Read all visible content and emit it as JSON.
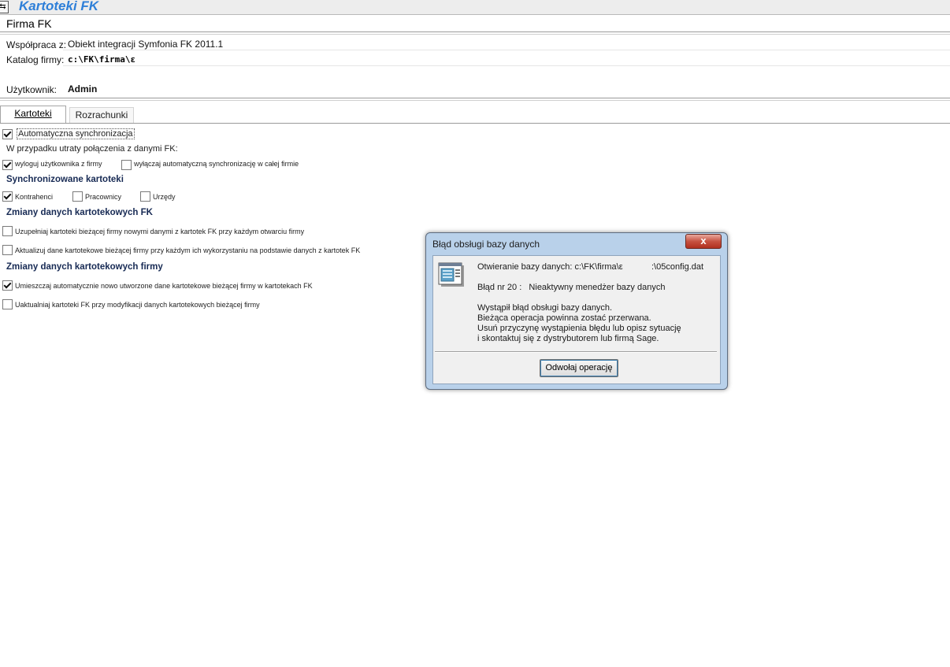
{
  "app": {
    "title": "Kartoteki FK",
    "menu_icon": "restore-icon"
  },
  "firma": {
    "title": "Firma FK",
    "wspolpraca_label": "Współpraca z:",
    "wspolpraca_value": "Obiekt integracji Symfonia FK 2011.1",
    "katalog_label": "Katalog firmy:",
    "katalog_value": "c:\\FK\\firma\\ε",
    "uzytkownik_label": "Użytkownik:",
    "uzytkownik_value": "Admin"
  },
  "tabs": [
    {
      "label": "Kartoteki",
      "active": true
    },
    {
      "label": "Rozrachunki",
      "active": false
    }
  ],
  "options": {
    "auto_sync": {
      "label": "Automatyczna synchronizacja",
      "checked": true
    },
    "lost_connection_label": "W przypadku utraty połączenia z danymi FK:",
    "logout_user": {
      "label": "wyloguj użytkownika z firmy",
      "checked": true
    },
    "disable_auto_sync": {
      "label": "wyłączaj automatyczną synchronizację w całej firmie",
      "checked": false
    },
    "sync_section_title": "Synchronizowane kartoteki",
    "kontrahenci": {
      "label": "Kontrahenci",
      "checked": true
    },
    "pracownicy": {
      "label": "Pracownicy",
      "checked": false
    },
    "urzedy": {
      "label": "Urzędy",
      "checked": false
    },
    "fk_changes_title": "Zmiany danych kartotekowych FK",
    "uzupelniaj": {
      "label": "Uzupełniaj kartoteki bieżącej firmy nowymi danymi z kartotek FK przy każdym otwarciu firmy",
      "checked": false
    },
    "aktualizuj": {
      "label": "Aktualizuj dane kartotekowe bieżącej firmy przy każdym ich wykorzystaniu na podstawie danych z kartotek FK",
      "checked": false
    },
    "firm_changes_title": "Zmiany danych kartotekowych firmy",
    "umieszczaj": {
      "label": "Umieszczaj automatycznie nowo utworzone dane kartotekowe bieżącej firmy w kartotekach FK",
      "checked": true
    },
    "uaktualniaj": {
      "label": "Uaktualniaj kartoteki FK przy modyfikacji danych kartotekowych bieżącej firmy",
      "checked": false
    }
  },
  "dialog": {
    "title": "Błąd obsługi bazy danych",
    "close_label": "x",
    "icon": "database-window-icon",
    "path_line_prefix": "Otwieranie bazy danych: c:\\FK\\firma\\ε",
    "path_line_suffix": ":\\05config.dat",
    "error_line": "Błąd nr 20 :   Nieaktywny menedżer bazy danych",
    "message_lines": [
      "Wystąpił błąd obsługi bazy danych.",
      "Bieżąca operacja powinna zostać przerwana.",
      "Usuń przyczynę wystąpienia błędu lub opisz sytuację",
      "i skontaktuj się z dystrybutorem lub firmą Sage."
    ],
    "cancel_button": "Odwołaj operację"
  }
}
